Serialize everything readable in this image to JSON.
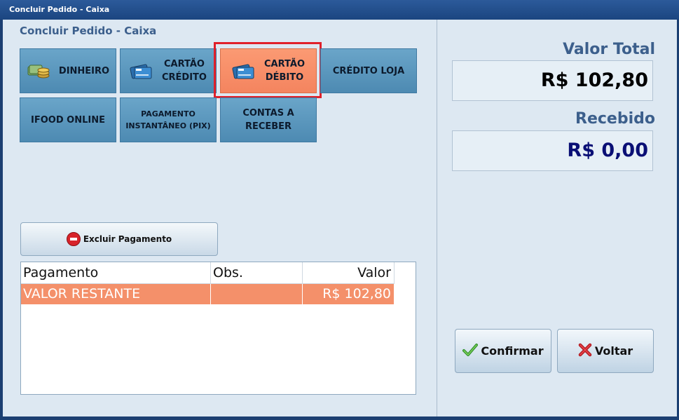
{
  "window": {
    "title": "Concluir Pedido - Caixa"
  },
  "panel": {
    "title": "Concluir Pedido - Caixa"
  },
  "payment_methods": [
    {
      "label": "DINHEIRO"
    },
    {
      "label": "CARTÃO\nCRÉDITO"
    },
    {
      "label": "CARTÃO\nDÉBITO",
      "selected": true
    },
    {
      "label": "CRÉDITO LOJA"
    },
    {
      "label": "IFOOD ONLINE"
    },
    {
      "label": "PAGAMENTO\nINSTANTÂNEO (PIX)"
    },
    {
      "label": "CONTAS A\nRECEBER"
    }
  ],
  "actions": {
    "excluir_label": "Excluir Pagamento"
  },
  "table": {
    "columns": [
      "Pagamento",
      "Obs.",
      "Valor"
    ],
    "rows": [
      {
        "pagamento": "VALOR RESTANTE",
        "obs": "",
        "valor": "R$ 102,80"
      }
    ]
  },
  "summary": {
    "valor_total_label": "Valor Total",
    "valor_total": "R$ 102,80",
    "recebido_label": "Recebido",
    "recebido": "R$ 0,00"
  },
  "buttons": {
    "confirmar": "Confirmar",
    "voltar": "Voltar"
  },
  "icons": {
    "dinheiro": "coins-icon",
    "cartao": "card-icon",
    "excluir": "minus-circle-icon",
    "confirmar": "checkmark-icon",
    "voltar": "x-icon"
  },
  "colors": {
    "selected": "#f4845f",
    "button": "#5a97be",
    "highlight_border": "#e0202a",
    "recebido_text": "#0a0f75"
  }
}
